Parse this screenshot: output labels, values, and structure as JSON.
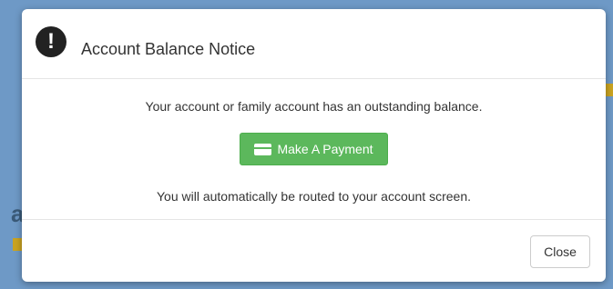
{
  "modal": {
    "title": "Account Balance Notice",
    "icon": "exclamation-circle-icon",
    "message": "Your account or family account has an outstanding balance.",
    "payment_button": {
      "label": "Make A Payment",
      "icon": "credit-card-icon",
      "color": "#5cb85c"
    },
    "routing_note": "You will automatically be routed to your account screen.",
    "close_button": {
      "label": "Close"
    }
  },
  "background": {
    "color": "#6e99c6",
    "accent": "#c9a321"
  }
}
